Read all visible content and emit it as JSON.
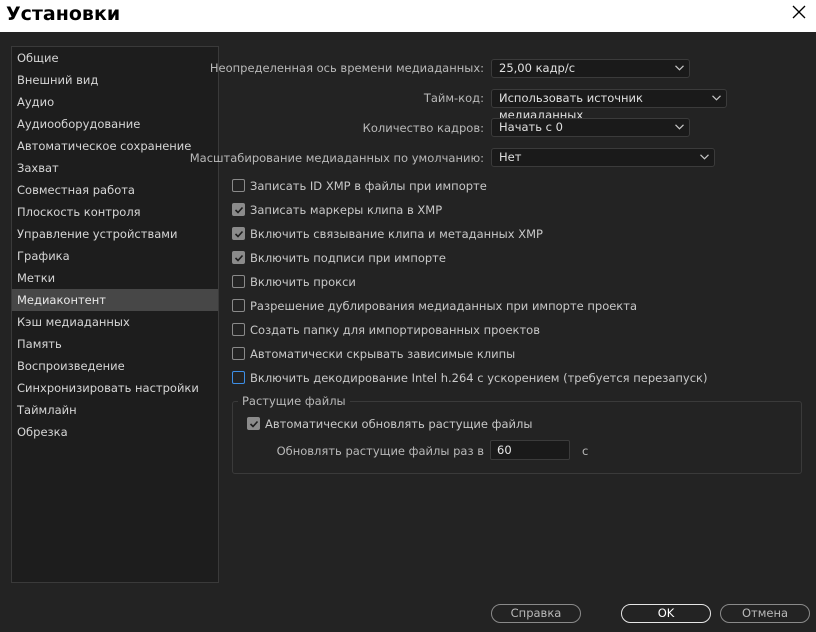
{
  "window": {
    "title": "Установки"
  },
  "sidebar": {
    "items": [
      {
        "label": "Общие"
      },
      {
        "label": "Внешний вид"
      },
      {
        "label": "Аудио"
      },
      {
        "label": "Аудиооборудование"
      },
      {
        "label": "Автоматическое сохранение"
      },
      {
        "label": "Захват"
      },
      {
        "label": "Совместная работа"
      },
      {
        "label": "Плоскость контроля"
      },
      {
        "label": "Управление устройствами"
      },
      {
        "label": "Графика"
      },
      {
        "label": "Метки"
      },
      {
        "label": "Медиаконтент"
      },
      {
        "label": "Кэш медиаданных"
      },
      {
        "label": "Память"
      },
      {
        "label": "Воспроизведение"
      },
      {
        "label": "Синхронизировать настройки"
      },
      {
        "label": "Таймлайн"
      },
      {
        "label": "Обрезка"
      }
    ],
    "selected": "Медиаконтент"
  },
  "settings": {
    "timebase": {
      "label": "Неопределенная ось времени медиаданных:",
      "value": "25,00 кадр/с"
    },
    "timecode": {
      "label": "Тайм-код:",
      "value": "Использовать источник медиаданных"
    },
    "frame_count": {
      "label": "Количество кадров:",
      "value": "Начать с 0"
    },
    "default_scaling": {
      "label": "Масштабирование медиаданных по умолчанию:",
      "value": "Нет"
    }
  },
  "checkboxes": [
    {
      "label": "Записать ID XMP в файлы при импорте",
      "checked": false
    },
    {
      "label": "Записать маркеры клипа в XMP",
      "checked": true
    },
    {
      "label": "Включить связывание клипа и метаданных XMP",
      "checked": true
    },
    {
      "label": "Включить подписи при импорте",
      "checked": true
    },
    {
      "label": "Включить прокси",
      "checked": false
    },
    {
      "label": "Разрешение дублирования медиаданных при импорте проекта",
      "checked": false
    },
    {
      "label": "Создать папку для импортированных проектов",
      "checked": false
    },
    {
      "label": "Автоматически скрывать зависимые клипы",
      "checked": false
    },
    {
      "label": "Включить декодирование Intel h.264 с ускорением (требуется перезапуск)",
      "checked": false,
      "focused": true
    }
  ],
  "growing_files": {
    "title": "Растущие файлы",
    "auto_refresh": {
      "label": "Автоматически обновлять растущие файлы",
      "checked": true
    },
    "interval": {
      "label": "Обновлять растущие файлы раз в",
      "value": "60",
      "unit": "с"
    }
  },
  "buttons": {
    "help": "Справка",
    "ok": "OK",
    "cancel": "Отмена"
  },
  "colors": {
    "background": "#232323",
    "panel": "#1d1d1d",
    "selection": "#474747",
    "focus": "#3d8ee6"
  },
  "icons": {
    "close": "close-icon",
    "dropdown": "chevron-down-icon",
    "check": "checkmark-icon"
  }
}
